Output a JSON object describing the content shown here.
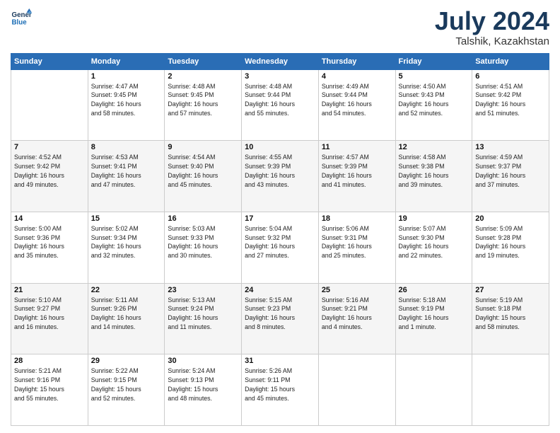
{
  "header": {
    "logo_line1": "General",
    "logo_line2": "Blue",
    "title": "July 2024",
    "location": "Talshik, Kazakhstan"
  },
  "days_of_week": [
    "Sunday",
    "Monday",
    "Tuesday",
    "Wednesday",
    "Thursday",
    "Friday",
    "Saturday"
  ],
  "weeks": [
    [
      {
        "num": "",
        "info": ""
      },
      {
        "num": "1",
        "info": "Sunrise: 4:47 AM\nSunset: 9:45 PM\nDaylight: 16 hours\nand 58 minutes."
      },
      {
        "num": "2",
        "info": "Sunrise: 4:48 AM\nSunset: 9:45 PM\nDaylight: 16 hours\nand 57 minutes."
      },
      {
        "num": "3",
        "info": "Sunrise: 4:48 AM\nSunset: 9:44 PM\nDaylight: 16 hours\nand 55 minutes."
      },
      {
        "num": "4",
        "info": "Sunrise: 4:49 AM\nSunset: 9:44 PM\nDaylight: 16 hours\nand 54 minutes."
      },
      {
        "num": "5",
        "info": "Sunrise: 4:50 AM\nSunset: 9:43 PM\nDaylight: 16 hours\nand 52 minutes."
      },
      {
        "num": "6",
        "info": "Sunrise: 4:51 AM\nSunset: 9:42 PM\nDaylight: 16 hours\nand 51 minutes."
      }
    ],
    [
      {
        "num": "7",
        "info": "Sunrise: 4:52 AM\nSunset: 9:42 PM\nDaylight: 16 hours\nand 49 minutes."
      },
      {
        "num": "8",
        "info": "Sunrise: 4:53 AM\nSunset: 9:41 PM\nDaylight: 16 hours\nand 47 minutes."
      },
      {
        "num": "9",
        "info": "Sunrise: 4:54 AM\nSunset: 9:40 PM\nDaylight: 16 hours\nand 45 minutes."
      },
      {
        "num": "10",
        "info": "Sunrise: 4:55 AM\nSunset: 9:39 PM\nDaylight: 16 hours\nand 43 minutes."
      },
      {
        "num": "11",
        "info": "Sunrise: 4:57 AM\nSunset: 9:39 PM\nDaylight: 16 hours\nand 41 minutes."
      },
      {
        "num": "12",
        "info": "Sunrise: 4:58 AM\nSunset: 9:38 PM\nDaylight: 16 hours\nand 39 minutes."
      },
      {
        "num": "13",
        "info": "Sunrise: 4:59 AM\nSunset: 9:37 PM\nDaylight: 16 hours\nand 37 minutes."
      }
    ],
    [
      {
        "num": "14",
        "info": "Sunrise: 5:00 AM\nSunset: 9:36 PM\nDaylight: 16 hours\nand 35 minutes."
      },
      {
        "num": "15",
        "info": "Sunrise: 5:02 AM\nSunset: 9:34 PM\nDaylight: 16 hours\nand 32 minutes."
      },
      {
        "num": "16",
        "info": "Sunrise: 5:03 AM\nSunset: 9:33 PM\nDaylight: 16 hours\nand 30 minutes."
      },
      {
        "num": "17",
        "info": "Sunrise: 5:04 AM\nSunset: 9:32 PM\nDaylight: 16 hours\nand 27 minutes."
      },
      {
        "num": "18",
        "info": "Sunrise: 5:06 AM\nSunset: 9:31 PM\nDaylight: 16 hours\nand 25 minutes."
      },
      {
        "num": "19",
        "info": "Sunrise: 5:07 AM\nSunset: 9:30 PM\nDaylight: 16 hours\nand 22 minutes."
      },
      {
        "num": "20",
        "info": "Sunrise: 5:09 AM\nSunset: 9:28 PM\nDaylight: 16 hours\nand 19 minutes."
      }
    ],
    [
      {
        "num": "21",
        "info": "Sunrise: 5:10 AM\nSunset: 9:27 PM\nDaylight: 16 hours\nand 16 minutes."
      },
      {
        "num": "22",
        "info": "Sunrise: 5:11 AM\nSunset: 9:26 PM\nDaylight: 16 hours\nand 14 minutes."
      },
      {
        "num": "23",
        "info": "Sunrise: 5:13 AM\nSunset: 9:24 PM\nDaylight: 16 hours\nand 11 minutes."
      },
      {
        "num": "24",
        "info": "Sunrise: 5:15 AM\nSunset: 9:23 PM\nDaylight: 16 hours\nand 8 minutes."
      },
      {
        "num": "25",
        "info": "Sunrise: 5:16 AM\nSunset: 9:21 PM\nDaylight: 16 hours\nand 4 minutes."
      },
      {
        "num": "26",
        "info": "Sunrise: 5:18 AM\nSunset: 9:19 PM\nDaylight: 16 hours\nand 1 minute."
      },
      {
        "num": "27",
        "info": "Sunrise: 5:19 AM\nSunset: 9:18 PM\nDaylight: 15 hours\nand 58 minutes."
      }
    ],
    [
      {
        "num": "28",
        "info": "Sunrise: 5:21 AM\nSunset: 9:16 PM\nDaylight: 15 hours\nand 55 minutes."
      },
      {
        "num": "29",
        "info": "Sunrise: 5:22 AM\nSunset: 9:15 PM\nDaylight: 15 hours\nand 52 minutes."
      },
      {
        "num": "30",
        "info": "Sunrise: 5:24 AM\nSunset: 9:13 PM\nDaylight: 15 hours\nand 48 minutes."
      },
      {
        "num": "31",
        "info": "Sunrise: 5:26 AM\nSunset: 9:11 PM\nDaylight: 15 hours\nand 45 minutes."
      },
      {
        "num": "",
        "info": ""
      },
      {
        "num": "",
        "info": ""
      },
      {
        "num": "",
        "info": ""
      }
    ]
  ]
}
